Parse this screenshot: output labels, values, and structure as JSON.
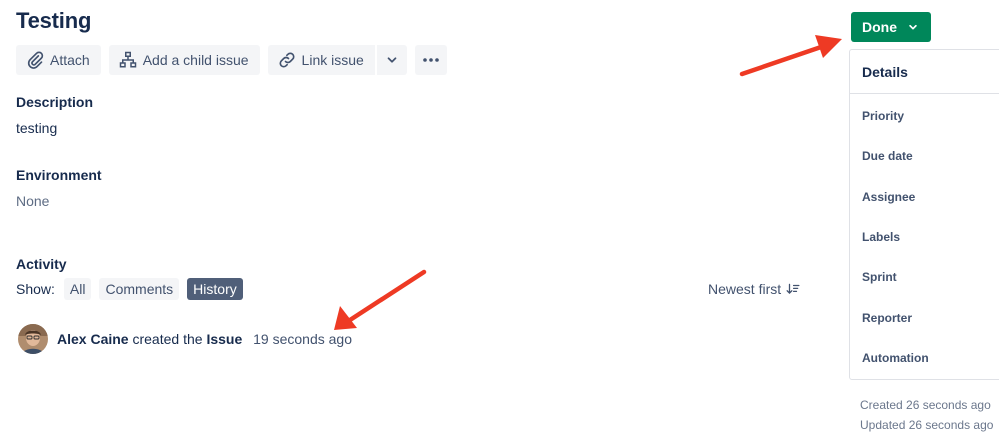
{
  "issue": {
    "title": "Testing"
  },
  "toolbar": {
    "attach_label": "Attach",
    "child_issue_label": "Add a child issue",
    "link_issue_label": "Link issue"
  },
  "description": {
    "label": "Description",
    "value": "testing"
  },
  "environment": {
    "label": "Environment",
    "value": "None"
  },
  "activity": {
    "label": "Activity",
    "show_label": "Show:",
    "filters": [
      "All",
      "Comments",
      "History"
    ],
    "active_filter": "History",
    "sort_label": "Newest first",
    "entry": {
      "user": "Alex Caine",
      "action": "created the",
      "object": "Issue",
      "time": "19 seconds ago"
    }
  },
  "status": {
    "label": "Done",
    "color": "#00875a"
  },
  "details": {
    "heading": "Details",
    "fields": [
      "Priority",
      "Due date",
      "Assignee",
      "Labels",
      "Sprint",
      "Reporter",
      "Automation"
    ]
  },
  "meta": {
    "created": "Created 26 seconds ago",
    "updated": "Updated 26 seconds ago"
  },
  "annotation_color": "#ee3a24"
}
